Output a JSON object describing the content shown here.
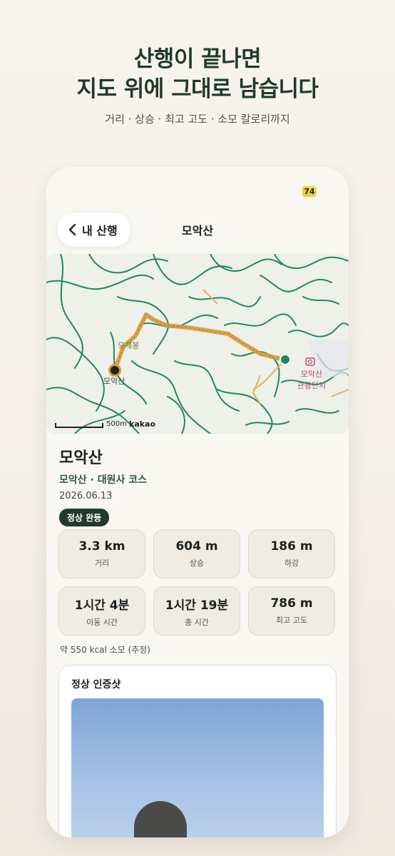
{
  "promo": {
    "headline_line1": "산행이 끝나면",
    "headline_line2": "지도 위에 그대로 남습니다",
    "subtitle": "거리 · 상승 · 최고 고도 · 소모 칼로리까지"
  },
  "status_bar": {
    "badge": "74"
  },
  "nav": {
    "back_label": "내 산행",
    "title": "모악산"
  },
  "map": {
    "peak_label": "모제봉",
    "start_label": "모악산",
    "spot_label_line1": "모악산",
    "spot_label_line2": "관광단지",
    "scale_label": "500m",
    "provider": "kakao",
    "route_color": "#d79a3b",
    "trail_color": "#1f8a5b"
  },
  "mountain": {
    "name": "모악산",
    "course": "모악산 · 대원사 코스",
    "date": "2026.06.13",
    "status_badge": "정상 완등"
  },
  "stats": [
    {
      "value": "3.3 km",
      "label": "거리"
    },
    {
      "value": "604 m",
      "label": "상승"
    },
    {
      "value": "186 m",
      "label": "하강"
    },
    {
      "value": "1시간 4분",
      "label": "이동 시간"
    },
    {
      "value": "1시간 19분",
      "label": "총 시간"
    },
    {
      "value": "786 m",
      "label": "최고 고도"
    }
  ],
  "calories": "약 550 kcal 소모 (추정)",
  "photo_card": {
    "title": "정상 인증샷"
  }
}
